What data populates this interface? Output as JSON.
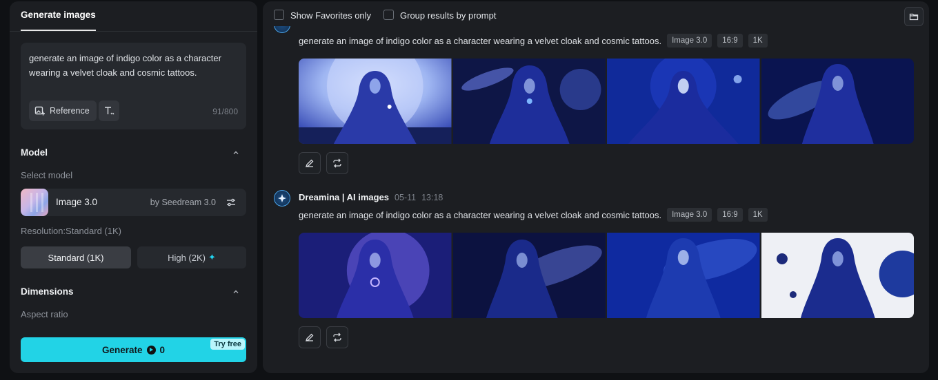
{
  "left_panel": {
    "tab": "Generate images",
    "prompt": {
      "text": "generate an image of indigo color as a character wearing a velvet cloak and cosmic tattoos.",
      "reference_label": "Reference",
      "char_count": "91/800"
    },
    "model_section": {
      "title": "Model",
      "select_label": "Select model",
      "model_name": "Image 3.0",
      "model_by": "by Seedream 3.0",
      "resolution_label": "Resolution:Standard (1K)",
      "resolution_options": [
        "Standard (1K)",
        "High (2K)"
      ],
      "selected_resolution": "Standard (1K)"
    },
    "dimensions_section": {
      "title": "Dimensions",
      "aspect_label": "Aspect ratio"
    },
    "generate": {
      "label": "Generate",
      "cost": "0",
      "badge": "Try free"
    }
  },
  "right_panel": {
    "filters": {
      "favorites": "Show Favorites only",
      "group": "Group results by prompt"
    },
    "results": [
      {
        "prompt": "generate an image of indigo color as a character wearing a velvet cloak and cosmic tattoos.",
        "tags": [
          "Image 3.0",
          "16:9",
          "1K"
        ],
        "images": [
          "hooded-figure-moon",
          "hooded-figure-galaxy",
          "hooded-figure-cosmic-rays",
          "hooded-figure-spiral-galaxy"
        ]
      },
      {
        "author": "Dreamina | AI images",
        "date": "05-11",
        "time": "13:18",
        "prompt": "generate an image of indigo color as a character wearing a velvet cloak and cosmic tattoos.",
        "tags": [
          "Image 3.0",
          "16:9",
          "1K"
        ],
        "images": [
          "hooded-figure-nebula",
          "hooded-figure-spiral",
          "hooded-figure-blue-stars",
          "hooded-figure-planets-white"
        ]
      }
    ]
  },
  "colors": {
    "accent": "#22d3e6",
    "panel": "#1c1e22",
    "background": "#0f1114"
  }
}
